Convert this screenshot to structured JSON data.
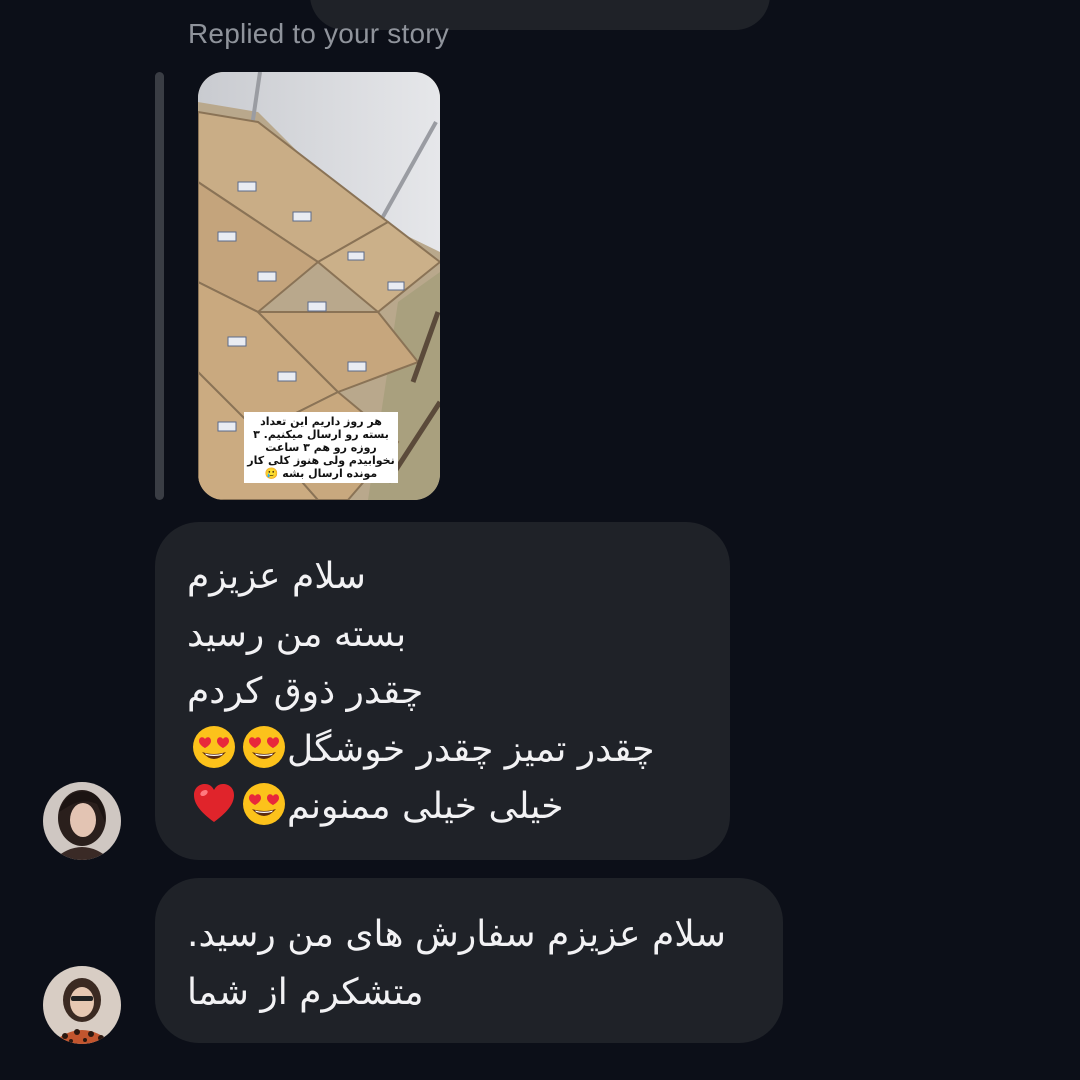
{
  "thread": {
    "reply_label": "Replied to your story",
    "story": {
      "caption": "هر روز داریم این تعداد بسته رو ارسال میکنیم. ۳ روزه رو هم ۳ ساعت نخوابیدم ولی هنوز کلی کار مونده ارسال بشه 🥲"
    },
    "messages": [
      {
        "lines": [
          {
            "text": "سلام عزیزم",
            "emojis": []
          },
          {
            "text": "بسته من رسید",
            "emojis": []
          },
          {
            "text": "چقدر ذوق کردم",
            "emojis": []
          },
          {
            "text": "چقدر تمیز چقدر خوشگل",
            "emojis": [
              "heart-eyes",
              "heart-eyes"
            ]
          },
          {
            "text": "خیلی خیلی ممنونم",
            "emojis": [
              "heart-eyes",
              "red-heart"
            ]
          }
        ]
      },
      {
        "lines": [
          {
            "text": "سلام عزیزم سفارش های من رسید.",
            "emojis": []
          },
          {
            "text": "متشکرم از شما",
            "emojis": []
          }
        ]
      }
    ]
  },
  "icons": {
    "avatar_1": "user-avatar-icon",
    "avatar_2": "user-avatar-icon",
    "emoji_heart_eyes": "heart-eyes-emoji-icon",
    "emoji_red_heart": "red-heart-emoji-icon"
  },
  "colors": {
    "background": "#0c0f18",
    "bubble": "#1f2228",
    "text": "#f2f2f4",
    "muted": "#8f939b"
  }
}
